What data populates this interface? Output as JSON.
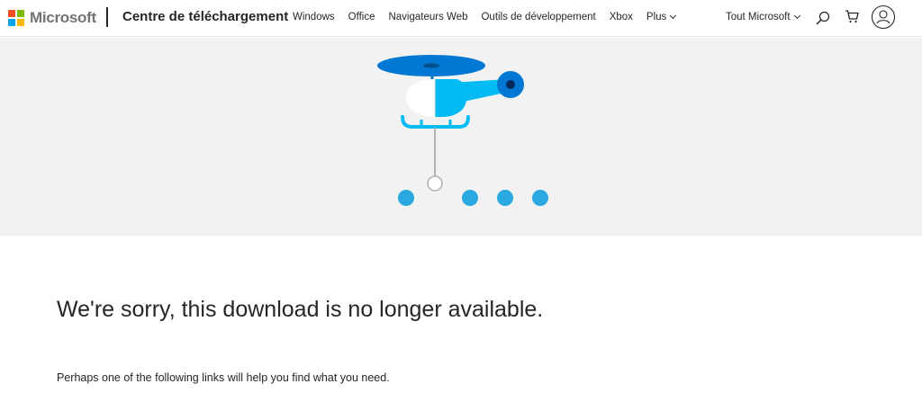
{
  "header": {
    "brand": "Microsoft",
    "site_title": "Centre de téléchargement",
    "nav": [
      {
        "label": "Windows"
      },
      {
        "label": "Office"
      },
      {
        "label": "Navigateurs Web"
      },
      {
        "label": "Outils de développement"
      },
      {
        "label": "Xbox"
      },
      {
        "label": "Plus"
      }
    ],
    "all_microsoft": "Tout Microsoft",
    "icons": {
      "search": "search-icon",
      "cart": "cart-icon",
      "account": "account-icon"
    },
    "logo_colors": [
      "#f25022",
      "#7fba00",
      "#00a4ef",
      "#ffb900"
    ]
  },
  "hero": {
    "illustration": "helicopter-icon",
    "colors": {
      "background": "#f2f2f2",
      "rotor": "#0078d4",
      "body": "#00bcf2",
      "cockpit": "#ffffff",
      "dots": "#2aa9e0"
    }
  },
  "content": {
    "heading": "We're sorry, this download is no longer available.",
    "help_text": "Perhaps one of the following links will help you find what you need."
  }
}
